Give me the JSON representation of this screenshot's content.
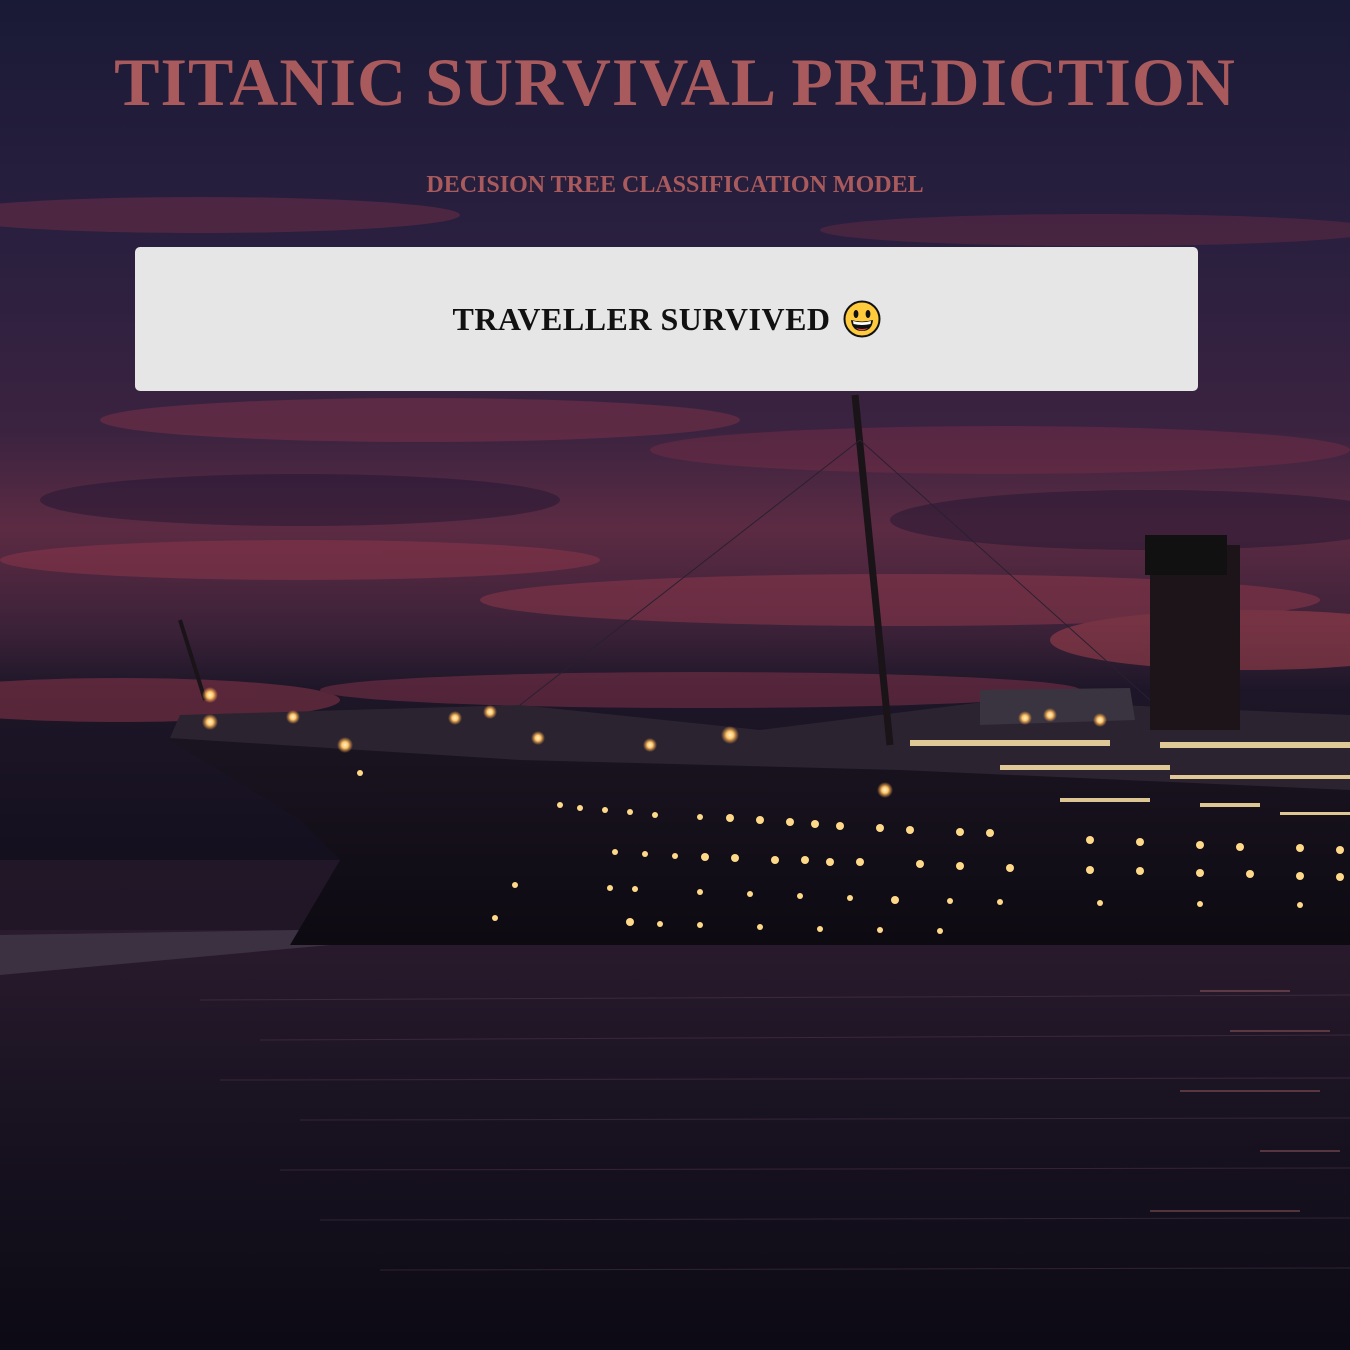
{
  "header": {
    "title": "TITANIC SURVIVAL PREDICTION",
    "subtitle": "DECISION TREE CLASSIFICATION MODEL"
  },
  "result": {
    "text": "TRAVELLER SURVIVED",
    "icon": "grinning-face-icon"
  },
  "colors": {
    "title": "#a85a5c",
    "subtitle": "#a85a5c",
    "card_background": "#e6e6e7",
    "result_text": "#111111"
  },
  "background": {
    "icon": "titanic-ship-at-night-image"
  }
}
